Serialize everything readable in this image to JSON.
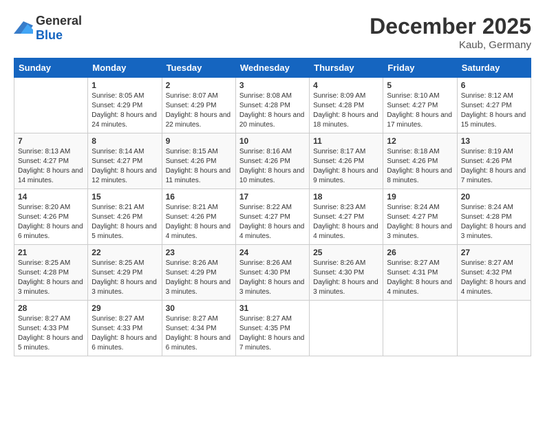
{
  "logo": {
    "general": "General",
    "blue": "Blue"
  },
  "title": "December 2025",
  "location": "Kaub, Germany",
  "days_of_week": [
    "Sunday",
    "Monday",
    "Tuesday",
    "Wednesday",
    "Thursday",
    "Friday",
    "Saturday"
  ],
  "weeks": [
    [
      {
        "day": "",
        "sunrise": "",
        "sunset": "",
        "daylight": ""
      },
      {
        "day": "1",
        "sunrise": "Sunrise: 8:05 AM",
        "sunset": "Sunset: 4:29 PM",
        "daylight": "Daylight: 8 hours and 24 minutes."
      },
      {
        "day": "2",
        "sunrise": "Sunrise: 8:07 AM",
        "sunset": "Sunset: 4:29 PM",
        "daylight": "Daylight: 8 hours and 22 minutes."
      },
      {
        "day": "3",
        "sunrise": "Sunrise: 8:08 AM",
        "sunset": "Sunset: 4:28 PM",
        "daylight": "Daylight: 8 hours and 20 minutes."
      },
      {
        "day": "4",
        "sunrise": "Sunrise: 8:09 AM",
        "sunset": "Sunset: 4:28 PM",
        "daylight": "Daylight: 8 hours and 18 minutes."
      },
      {
        "day": "5",
        "sunrise": "Sunrise: 8:10 AM",
        "sunset": "Sunset: 4:27 PM",
        "daylight": "Daylight: 8 hours and 17 minutes."
      },
      {
        "day": "6",
        "sunrise": "Sunrise: 8:12 AM",
        "sunset": "Sunset: 4:27 PM",
        "daylight": "Daylight: 8 hours and 15 minutes."
      }
    ],
    [
      {
        "day": "7",
        "sunrise": "Sunrise: 8:13 AM",
        "sunset": "Sunset: 4:27 PM",
        "daylight": "Daylight: 8 hours and 14 minutes."
      },
      {
        "day": "8",
        "sunrise": "Sunrise: 8:14 AM",
        "sunset": "Sunset: 4:27 PM",
        "daylight": "Daylight: 8 hours and 12 minutes."
      },
      {
        "day": "9",
        "sunrise": "Sunrise: 8:15 AM",
        "sunset": "Sunset: 4:26 PM",
        "daylight": "Daylight: 8 hours and 11 minutes."
      },
      {
        "day": "10",
        "sunrise": "Sunrise: 8:16 AM",
        "sunset": "Sunset: 4:26 PM",
        "daylight": "Daylight: 8 hours and 10 minutes."
      },
      {
        "day": "11",
        "sunrise": "Sunrise: 8:17 AM",
        "sunset": "Sunset: 4:26 PM",
        "daylight": "Daylight: 8 hours and 9 minutes."
      },
      {
        "day": "12",
        "sunrise": "Sunrise: 8:18 AM",
        "sunset": "Sunset: 4:26 PM",
        "daylight": "Daylight: 8 hours and 8 minutes."
      },
      {
        "day": "13",
        "sunrise": "Sunrise: 8:19 AM",
        "sunset": "Sunset: 4:26 PM",
        "daylight": "Daylight: 8 hours and 7 minutes."
      }
    ],
    [
      {
        "day": "14",
        "sunrise": "Sunrise: 8:20 AM",
        "sunset": "Sunset: 4:26 PM",
        "daylight": "Daylight: 8 hours and 6 minutes."
      },
      {
        "day": "15",
        "sunrise": "Sunrise: 8:21 AM",
        "sunset": "Sunset: 4:26 PM",
        "daylight": "Daylight: 8 hours and 5 minutes."
      },
      {
        "day": "16",
        "sunrise": "Sunrise: 8:21 AM",
        "sunset": "Sunset: 4:26 PM",
        "daylight": "Daylight: 8 hours and 4 minutes."
      },
      {
        "day": "17",
        "sunrise": "Sunrise: 8:22 AM",
        "sunset": "Sunset: 4:27 PM",
        "daylight": "Daylight: 8 hours and 4 minutes."
      },
      {
        "day": "18",
        "sunrise": "Sunrise: 8:23 AM",
        "sunset": "Sunset: 4:27 PM",
        "daylight": "Daylight: 8 hours and 4 minutes."
      },
      {
        "day": "19",
        "sunrise": "Sunrise: 8:24 AM",
        "sunset": "Sunset: 4:27 PM",
        "daylight": "Daylight: 8 hours and 3 minutes."
      },
      {
        "day": "20",
        "sunrise": "Sunrise: 8:24 AM",
        "sunset": "Sunset: 4:28 PM",
        "daylight": "Daylight: 8 hours and 3 minutes."
      }
    ],
    [
      {
        "day": "21",
        "sunrise": "Sunrise: 8:25 AM",
        "sunset": "Sunset: 4:28 PM",
        "daylight": "Daylight: 8 hours and 3 minutes."
      },
      {
        "day": "22",
        "sunrise": "Sunrise: 8:25 AM",
        "sunset": "Sunset: 4:29 PM",
        "daylight": "Daylight: 8 hours and 3 minutes."
      },
      {
        "day": "23",
        "sunrise": "Sunrise: 8:26 AM",
        "sunset": "Sunset: 4:29 PM",
        "daylight": "Daylight: 8 hours and 3 minutes."
      },
      {
        "day": "24",
        "sunrise": "Sunrise: 8:26 AM",
        "sunset": "Sunset: 4:30 PM",
        "daylight": "Daylight: 8 hours and 3 minutes."
      },
      {
        "day": "25",
        "sunrise": "Sunrise: 8:26 AM",
        "sunset": "Sunset: 4:30 PM",
        "daylight": "Daylight: 8 hours and 3 minutes."
      },
      {
        "day": "26",
        "sunrise": "Sunrise: 8:27 AM",
        "sunset": "Sunset: 4:31 PM",
        "daylight": "Daylight: 8 hours and 4 minutes."
      },
      {
        "day": "27",
        "sunrise": "Sunrise: 8:27 AM",
        "sunset": "Sunset: 4:32 PM",
        "daylight": "Daylight: 8 hours and 4 minutes."
      }
    ],
    [
      {
        "day": "28",
        "sunrise": "Sunrise: 8:27 AM",
        "sunset": "Sunset: 4:33 PM",
        "daylight": "Daylight: 8 hours and 5 minutes."
      },
      {
        "day": "29",
        "sunrise": "Sunrise: 8:27 AM",
        "sunset": "Sunset: 4:33 PM",
        "daylight": "Daylight: 8 hours and 6 minutes."
      },
      {
        "day": "30",
        "sunrise": "Sunrise: 8:27 AM",
        "sunset": "Sunset: 4:34 PM",
        "daylight": "Daylight: 8 hours and 6 minutes."
      },
      {
        "day": "31",
        "sunrise": "Sunrise: 8:27 AM",
        "sunset": "Sunset: 4:35 PM",
        "daylight": "Daylight: 8 hours and 7 minutes."
      },
      {
        "day": "",
        "sunrise": "",
        "sunset": "",
        "daylight": ""
      },
      {
        "day": "",
        "sunrise": "",
        "sunset": "",
        "daylight": ""
      },
      {
        "day": "",
        "sunrise": "",
        "sunset": "",
        "daylight": ""
      }
    ]
  ]
}
